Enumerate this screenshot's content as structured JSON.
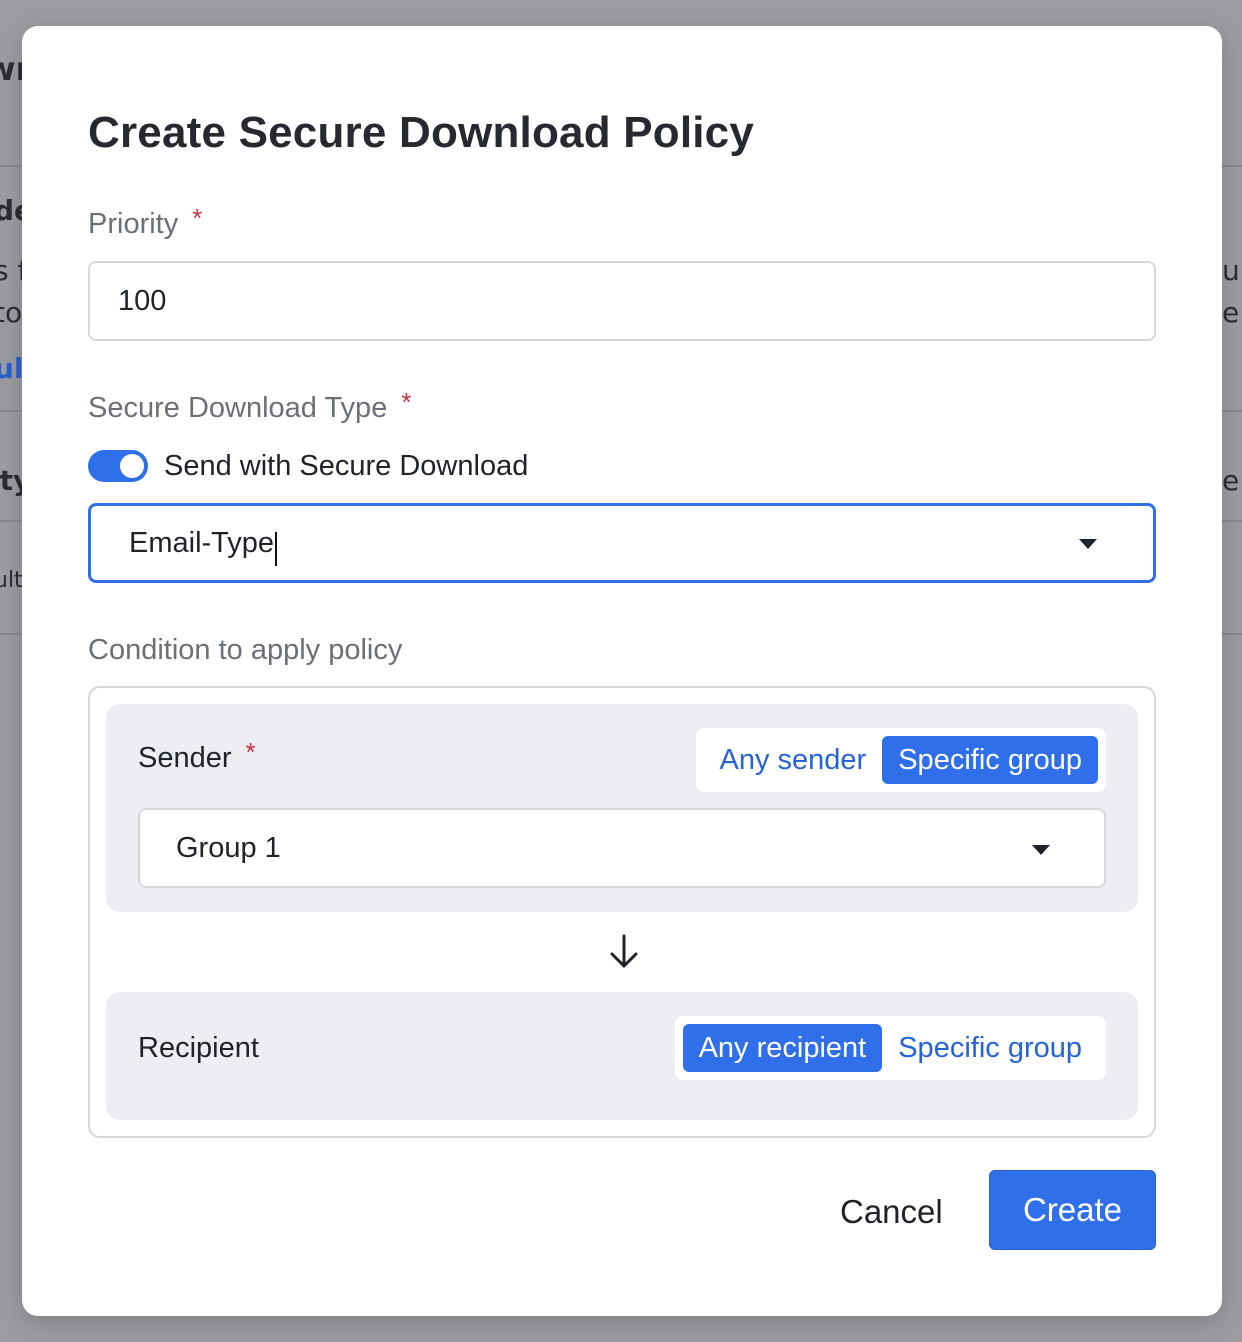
{
  "background": {
    "fragments_left": [
      "wr",
      "de",
      "s fi",
      "to",
      "ult",
      "ity",
      "ult"
    ],
    "fragments_right": [
      "ult",
      "e r",
      "e"
    ]
  },
  "dialog": {
    "title": "Create Secure Download Policy",
    "priority": {
      "label": "Priority",
      "required_mark": "*",
      "value": "100"
    },
    "secure_download_type": {
      "label": "Secure Download Type",
      "required_mark": "*",
      "toggle_label": "Send with Secure Download",
      "toggle_on": true,
      "selected_value": "Email-Type"
    },
    "condition": {
      "label": "Condition to apply policy",
      "sender": {
        "label": "Sender",
        "required_mark": "*",
        "options": [
          "Any sender",
          "Specific group"
        ],
        "active_option": "Specific group",
        "group_selected": "Group 1"
      },
      "recipient": {
        "label": "Recipient",
        "options": [
          "Any recipient",
          "Specific group"
        ],
        "active_option": "Any recipient"
      }
    },
    "buttons": {
      "cancel": "Cancel",
      "create": "Create"
    }
  },
  "colors": {
    "accent": "#2f6fea",
    "link": "#2563d9",
    "required": "#c9313d",
    "card_bg": "#edeef1",
    "overlay": "#9a9ca1"
  },
  "icons": {
    "dropdown": "chevron-down-icon",
    "flow": "arrow-down-icon"
  }
}
